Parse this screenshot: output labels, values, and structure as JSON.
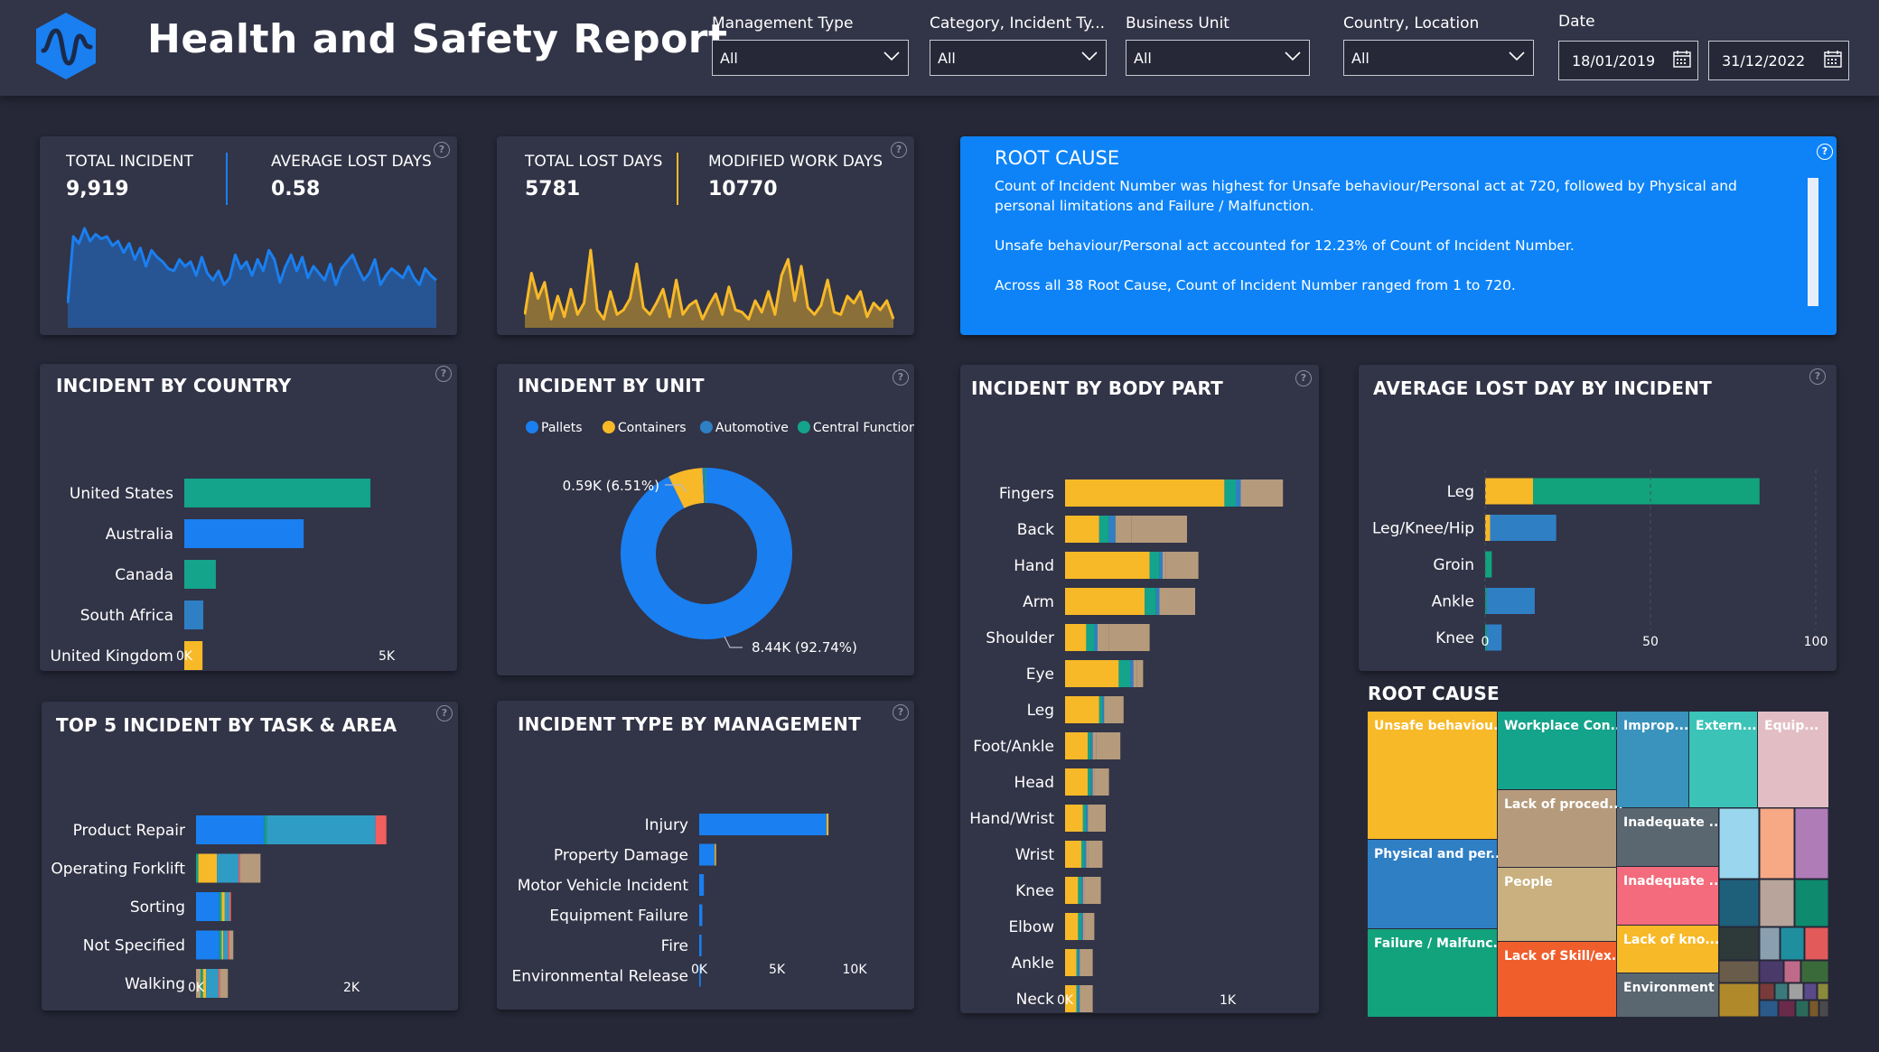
{
  "header": {
    "title": "Health and Safety Report",
    "filters": [
      {
        "label": "Management Type",
        "value": "All"
      },
      {
        "label": "Category, Incident Ty...",
        "value": "All"
      },
      {
        "label": "Business Unit",
        "value": "All"
      },
      {
        "label": "Country, Location",
        "value": "All"
      }
    ],
    "date": {
      "label": "Date",
      "start": "18/01/2019",
      "end": "31/12/2022"
    }
  },
  "kpi1": {
    "label_a": "TOTAL INCIDENT",
    "value_a": "9,919",
    "label_b": "AVERAGE LOST DAYS",
    "value_b": "0.58",
    "color": "#1a7ff0"
  },
  "kpi2": {
    "label_a": "TOTAL LOST DAYS",
    "value_a": "5781",
    "label_b": "MODIFIED WORK DAYS",
    "value_b": "10770",
    "color": "#f7b928"
  },
  "root_cause_text": {
    "title": "ROOT CAUSE",
    "para1": "Count of Incident Number was highest for Unsafe behaviour/Personal act at 720, followed by Physical and personal limitations and Failure / Malfunction.",
    "para2": "Unsafe behaviour/Personal act accounted for 12.23% of Count of Incident Number.",
    "para3": "Across all 38 Root Cause, Count of Incident Number ranged from 1 to 720."
  },
  "cards": {
    "country": "INCIDENT BY COUNTRY",
    "unit": "INCIDENT BY UNIT",
    "body": "INCIDENT BY BODY PART",
    "lost": "AVERAGE LOST DAY BY INCIDENT",
    "task": "TOP 5 INCIDENT BY TASK & AREA",
    "mgmt": "INCIDENT TYPE BY MANAGEMENT",
    "treemap": "ROOT CAUSE"
  },
  "colors": {
    "blue": "#1a7ff0",
    "yellow": "#f7b928",
    "teal": "#14a38b",
    "tan": "#b59b7c",
    "steel": "#2f7fc5",
    "green": "#12a37d"
  },
  "chart_data": [
    {
      "id": "kpi1_trend",
      "type": "area",
      "values": [
        20,
        78,
        72,
        85,
        74,
        80,
        76,
        78,
        70,
        74,
        64,
        72,
        58,
        68,
        52,
        66,
        60,
        56,
        50,
        48,
        58,
        52,
        56,
        44,
        60,
        46,
        40,
        48,
        36,
        42,
        62,
        50,
        56,
        44,
        58,
        48,
        66,
        58,
        38,
        52,
        62,
        48,
        60,
        42,
        52,
        46,
        40,
        54,
        36,
        50,
        56,
        62,
        50,
        40,
        46,
        58,
        36,
        44,
        50,
        46,
        42,
        52,
        42,
        36,
        50,
        44,
        40
      ]
    },
    {
      "id": "kpi2_trend",
      "type": "area",
      "values": [
        10,
        46,
        24,
        38,
        6,
        26,
        8,
        32,
        10,
        20,
        66,
        14,
        6,
        30,
        10,
        14,
        24,
        54,
        16,
        10,
        20,
        32,
        8,
        40,
        10,
        18,
        22,
        6,
        18,
        28,
        10,
        34,
        14,
        12,
        6,
        22,
        12,
        30,
        10,
        44,
        58,
        22,
        52,
        16,
        10,
        18,
        40,
        12,
        10,
        26,
        20,
        30,
        8,
        20,
        14,
        22,
        6
      ]
    },
    {
      "id": "country",
      "type": "bar",
      "title": "INCIDENT BY COUNTRY",
      "categories": [
        "United States",
        "Australia",
        "Canada",
        "South Africa",
        "United Kingdom"
      ],
      "values": [
        4600,
        2950,
        780,
        470,
        450
      ],
      "bar_colors": [
        "#14a38b",
        "#1a7ff0",
        "#14a38b",
        "#2f7fc5",
        "#f7b928"
      ],
      "xticks": [
        "0K",
        "5K"
      ],
      "xlim": [
        0,
        5000
      ]
    },
    {
      "id": "unit",
      "type": "pie",
      "title": "INCIDENT BY UNIT",
      "legend": [
        {
          "name": "Pallets",
          "color": "#1a7ff0"
        },
        {
          "name": "Containers",
          "color": "#f7b928"
        },
        {
          "name": "Automotive",
          "color": "#2f7fc5"
        },
        {
          "name": "Central Functions",
          "color": "#14a38b"
        }
      ],
      "slices": [
        {
          "name": "Pallets",
          "value": 92.74,
          "color": "#1a7ff0"
        },
        {
          "name": "Containers",
          "value": 6.51,
          "color": "#f7b928"
        },
        {
          "name": "Automotive",
          "value": 0.45,
          "color": "#2f7fc5"
        },
        {
          "name": "Central Functions",
          "value": 0.3,
          "color": "#14a38b"
        }
      ],
      "labels": [
        "0.59K (6.51%)",
        "8.44K (92.74%)"
      ]
    },
    {
      "id": "body",
      "type": "bar",
      "title": "INCIDENT BY BODY PART",
      "categories": [
        "Fingers",
        "Back",
        "Hand",
        "Arm",
        "Shoulder",
        "Eye",
        "Leg",
        "Foot/Ankle",
        "Head",
        "Hand/Wrist",
        "Wrist",
        "Knee",
        "Elbow",
        "Ankle",
        "Neck"
      ],
      "series": [
        {
          "color": "#f7b928",
          "values": [
            980,
            210,
            520,
            490,
            130,
            330,
            210,
            140,
            140,
            110,
            100,
            80,
            80,
            70,
            70
          ]
        },
        {
          "color": "#14a38b",
          "values": [
            70,
            60,
            60,
            70,
            50,
            70,
            20,
            20,
            20,
            20,
            20,
            20,
            20,
            10,
            10
          ]
        },
        {
          "color": "#2f7fc5",
          "values": [
            30,
            40,
            20,
            20,
            20,
            20,
            10,
            10,
            10,
            10,
            10,
            10,
            10,
            10,
            10
          ]
        },
        {
          "color": "#b59b7c",
          "values": [
            20,
            100,
            20,
            20,
            70,
            20,
            10,
            20,
            10,
            10,
            10,
            10,
            10,
            10,
            10
          ]
        },
        {
          "color": "#b59b7c",
          "values": [
            240,
            340,
            200,
            200,
            250,
            40,
            110,
            150,
            90,
            100,
            90,
            100,
            60,
            70,
            70
          ]
        }
      ],
      "xticks": [
        "0K",
        "1K"
      ],
      "xlim": [
        0,
        1000
      ]
    },
    {
      "id": "lost",
      "type": "bar",
      "title": "AVERAGE LOST DAY BY INCIDENT",
      "categories": [
        "Leg",
        "Leg/Knee/Hip",
        "Groin",
        "Ankle",
        "Knee"
      ],
      "series": [
        {
          "color": "#f7b928",
          "values": [
            14.5,
            1.5,
            0,
            0,
            0
          ]
        },
        {
          "color": "#12a37d",
          "values": [
            68.5,
            0,
            2,
            0.5,
            0.5
          ]
        },
        {
          "color": "#2f7fc5",
          "values": [
            0,
            20,
            0,
            14.5,
            4.5
          ]
        }
      ],
      "xticks": [
        "0",
        "50",
        "100"
      ],
      "xlim": [
        0,
        100
      ]
    },
    {
      "id": "task",
      "type": "bar",
      "title": "TOP 5 INCIDENT BY TASK & AREA",
      "categories": [
        "Product Repair",
        "Operating Forklift",
        "Sorting",
        "Not Specified",
        "Walking"
      ],
      "series": [
        {
          "color": "#1a7ff0",
          "values": [
            880,
            0,
            300,
            300,
            0
          ]
        },
        {
          "color": "#b59b7c",
          "values": [
            0,
            0,
            0,
            0,
            60
          ]
        },
        {
          "color": "#12a37d",
          "values": [
            30,
            30,
            30,
            30,
            30
          ]
        },
        {
          "color": "#f7b928",
          "values": [
            0,
            240,
            40,
            20,
            40
          ]
        },
        {
          "color": "#2f9cc5",
          "values": [
            1400,
            280,
            60,
            60,
            160
          ]
        },
        {
          "color": "#f05e5e",
          "values": [
            140,
            20,
            20,
            20,
            20
          ]
        },
        {
          "color": "#b59b7c",
          "values": [
            0,
            260,
            0,
            50,
            100
          ]
        }
      ],
      "xticks": [
        "0K",
        "2K"
      ],
      "xlim": [
        0,
        2000
      ]
    },
    {
      "id": "mgmt",
      "type": "bar",
      "title": "INCIDENT TYPE BY MANAGEMENT",
      "categories": [
        "Injury",
        "Property Damage",
        "Motor Vehicle Incident",
        "Equipment Failure",
        "Fire",
        "Environmental Release"
      ],
      "series": [
        {
          "color": "#1a7ff0",
          "values": [
            8200,
            1000,
            300,
            200,
            150,
            100
          ]
        },
        {
          "color": "#f7b928",
          "values": [
            120,
            80,
            0,
            0,
            0,
            0
          ]
        }
      ],
      "xticks": [
        "0K",
        "5K",
        "10K"
      ],
      "xlim": [
        0,
        10000
      ]
    },
    {
      "id": "treemap",
      "type": "heatmap",
      "title": "ROOT CAUSE",
      "tiles": [
        {
          "label": "Unsafe behaviou...",
          "color": "#f7b928"
        },
        {
          "label": "Physical and per...",
          "color": "#2f7fc5"
        },
        {
          "label": "Failure / Malfunc...",
          "color": "#12a37d"
        },
        {
          "label": "Workplace Con...",
          "color": "#14a38b"
        },
        {
          "label": "Lack of proced...",
          "color": "#b59b7c"
        },
        {
          "label": "People",
          "color": "#c9b07e"
        },
        {
          "label": "Lack of Skill/ex...",
          "color": "#f05e2c"
        },
        {
          "label": "Improp...",
          "color": "#3a93bc"
        },
        {
          "label": "Extern...",
          "color": "#3cc3b8"
        },
        {
          "label": "Equip...",
          "color": "#e2bec4"
        },
        {
          "label": "Inadequate ...",
          "color": "#5a6670"
        },
        {
          "label": "Inadequate ...",
          "color": "#f36b7c"
        },
        {
          "label": "Lack of kno...",
          "color": "#f7b928"
        },
        {
          "label": "Environment",
          "color": "#5a6670"
        }
      ]
    }
  ]
}
